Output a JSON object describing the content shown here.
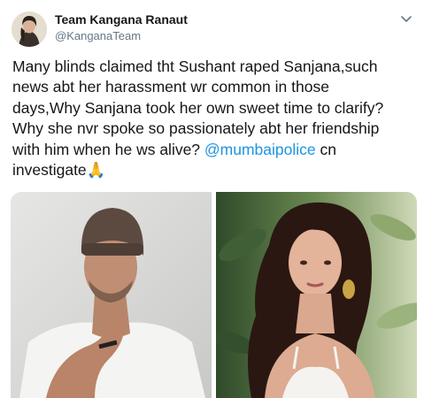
{
  "tweet": {
    "author_name": "Team Kangana Ranaut",
    "author_handle": "@KanganaTeam",
    "text_lines": [
      "Many blinds claimed tht Sushant raped Sanjana,such",
      "news abt her harassment wr common in those",
      "days,Why Sanjana took her own sweet time to clarify?",
      "Why she nvr spoke so passionately abt her friendship"
    ],
    "line5_before": "with him when he ws alive? ",
    "mention": "@mumbaipolice",
    "line5_after": " cn",
    "line6": "investigate",
    "emoji": "🙏"
  },
  "colors": {
    "mention": "#1b95e0",
    "name": "#14171a",
    "handle": "#657786"
  },
  "icons": {
    "menu": "chevron-down-icon",
    "avatar": "avatar",
    "emoji": "folded-hands-emoji"
  }
}
